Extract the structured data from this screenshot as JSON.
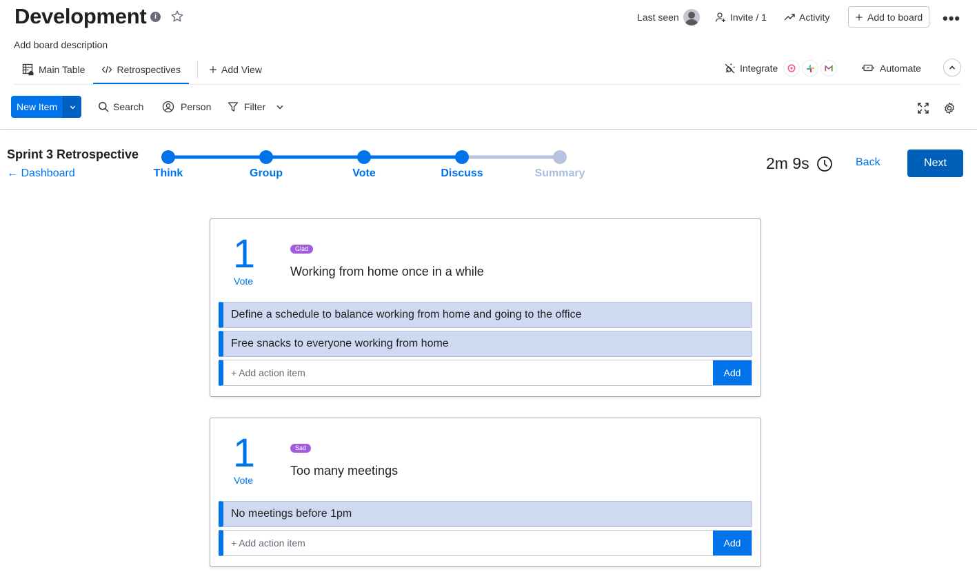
{
  "header": {
    "board_title": "Development",
    "info_glyph": "i",
    "board_description": "Add board description",
    "last_seen_label": "Last seen",
    "invite_label": "Invite / 1",
    "activity_label": "Activity",
    "add_to_board_label": "Add to board",
    "more_label": "•••"
  },
  "tabs": [
    {
      "label": "Main Table",
      "icon": "table-icon"
    },
    {
      "label": "Retrospectives",
      "icon": "code-icon",
      "active": true
    },
    {
      "label": "Add View",
      "icon": "plus-icon"
    }
  ],
  "integrations": {
    "integrate_label": "Integrate",
    "automate_label": "Automate",
    "logos": [
      "app-logo-pink",
      "slack-logo",
      "gmail-logo"
    ]
  },
  "toolbar": {
    "new_item_label": "New Item",
    "search_label": "Search",
    "person_label": "Person",
    "filter_label": "Filter"
  },
  "retro": {
    "sprint_title": "Sprint 3 Retrospective",
    "dashboard_link": "← Dashboard",
    "steps": [
      {
        "label": "Think",
        "state": "done"
      },
      {
        "label": "Group",
        "state": "done"
      },
      {
        "label": "Vote",
        "state": "done"
      },
      {
        "label": "Discuss",
        "state": "current"
      },
      {
        "label": "Summary",
        "state": "future"
      }
    ],
    "timer": "2m 9s",
    "back_label": "Back",
    "next_label": "Next",
    "accent_color": "#0073ea",
    "future_color": "#a9bedf"
  },
  "cards": [
    {
      "votes": "1",
      "vote_label": "Vote",
      "tag": "Glad",
      "topic": "Working from home once in a while",
      "actions": [
        "Define a schedule to balance working from home and going to the office",
        "Free snacks to everyone working from home"
      ],
      "add_placeholder": "+ Add action item",
      "add_label": "Add"
    },
    {
      "votes": "1",
      "vote_label": "Vote",
      "tag": "Sad",
      "topic": "Too many meetings",
      "actions": [
        "No meetings before 1pm"
      ],
      "add_placeholder": "+ Add action item",
      "add_label": "Add"
    }
  ]
}
